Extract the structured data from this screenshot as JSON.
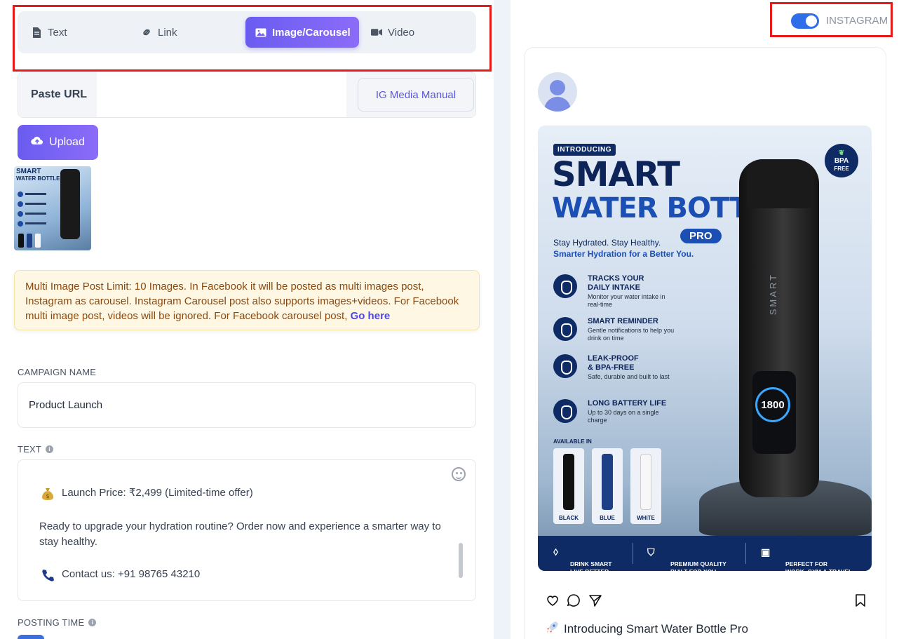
{
  "post_types": {
    "tabs": [
      {
        "label": "Text",
        "icon": "document-icon"
      },
      {
        "label": "Link",
        "icon": "link-icon"
      },
      {
        "label": "Image/Carousel",
        "icon": "image-icon"
      },
      {
        "label": "Video",
        "icon": "video-icon"
      }
    ],
    "active": "Image/Carousel"
  },
  "media": {
    "paste_url_label": "Paste URL",
    "url_value": "",
    "ig_manual_label": "IG Media Manual",
    "upload_label": "Upload"
  },
  "notice": {
    "text": "Multi Image Post Limit: 10 Images. In Facebook it will be posted as multi images post, Instagram as carousel. Instagram Carousel post also supports images+videos. For Facebook multi image post, videos will be ignored. For Facebook carousel post,",
    "link": "Go here"
  },
  "campaign": {
    "label": "CAMPAIGN NAME",
    "value": "Product Launch"
  },
  "text_field": {
    "label": "TEXT",
    "lines": {
      "price": "Launch Price: ₹2,499 (Limited-time offer)",
      "cta": "Ready to upgrade your hydration routine? Order now and experience a smarter way to stay healthy.",
      "contact": "Contact us: +91 98765 43210"
    }
  },
  "posting_time": {
    "label": "POSTING TIME"
  },
  "preview": {
    "platform_label": "INSTAGRAM",
    "platform_enabled": true,
    "caption": "Introducing Smart Water Bottle Pro",
    "image": {
      "badge": "INTRODUCING",
      "title_line1": "SMART",
      "title_line2": "WATER BOTTLE",
      "pro": "PRO",
      "tagline1": "Stay Hydrated. Stay Healthy.",
      "tagline2": "Smarter Hydration for a Better You.",
      "bpa_line1": "BPA",
      "bpa_line2": "FREE",
      "features": [
        {
          "title": "TRACKS YOUR\nDAILY INTAKE",
          "sub": "Monitor your water intake in real-time"
        },
        {
          "title": "SMART REMINDER",
          "sub": "Gentle notifications to help you drink on time"
        },
        {
          "title": "LEAK-PROOF\n& BPA-FREE",
          "sub": "Safe, durable and built to last"
        },
        {
          "title": "LONG BATTERY LIFE",
          "sub": "Up to 30 days on a single charge"
        }
      ],
      "available_in": "AVAILABLE IN",
      "colors": [
        "BLACK",
        "BLUE",
        "WHITE"
      ],
      "bottle_brand": "SMART",
      "display_value": "1800",
      "footer": [
        "DRINK SMART\nLIVE BETTER",
        "PREMIUM QUALITY\nBUILT FOR YOU",
        "PERFECT FOR\nWORK, GYM & TRAVEL"
      ]
    }
  },
  "colors": {
    "accent": "#6a5cf0",
    "highlight_border": "#e41b1b",
    "toggle_on": "#2f6ee8"
  }
}
